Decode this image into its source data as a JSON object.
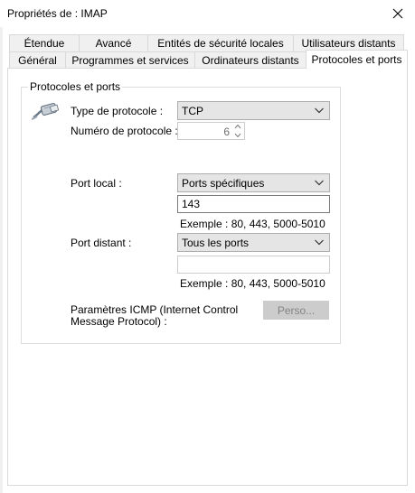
{
  "window": {
    "title": "Propriétés de : IMAP",
    "close_glyph": "✕"
  },
  "tabs_row1": [
    {
      "label": "Étendue"
    },
    {
      "label": "Avancé"
    },
    {
      "label": "Entités de sécurité locales"
    },
    {
      "label": "Utilisateurs distants"
    }
  ],
  "tabs_row2": [
    {
      "label": "Général"
    },
    {
      "label": "Programmes et services"
    },
    {
      "label": "Ordinateurs distants"
    },
    {
      "label": "Protocoles et ports",
      "selected": true
    }
  ],
  "group": {
    "title": "Protocoles et ports",
    "icon": "network-cable-icon"
  },
  "protocol_type": {
    "label": "Type de protocole :",
    "value": "TCP"
  },
  "protocol_number": {
    "label": "Numéro de protocole :",
    "value": "6"
  },
  "local_port": {
    "label": "Port local :",
    "mode": "Ports spécifiques",
    "value": "143",
    "example": "Exemple : 80, 443, 5000-5010"
  },
  "remote_port": {
    "label": "Port distant :",
    "mode": "Tous les ports",
    "value": "",
    "example": "Exemple : 80, 443, 5000-5010"
  },
  "icmp": {
    "label_line1": "Paramètres ICMP (Internet Control",
    "label_line2": "Message Protocol) :",
    "button": "Perso..."
  },
  "colors": {
    "tab_bg": "#f0f0f0",
    "combo_bg": "#e5e5e5",
    "disabled_text": "#838383",
    "border": "#d9d9d9"
  }
}
